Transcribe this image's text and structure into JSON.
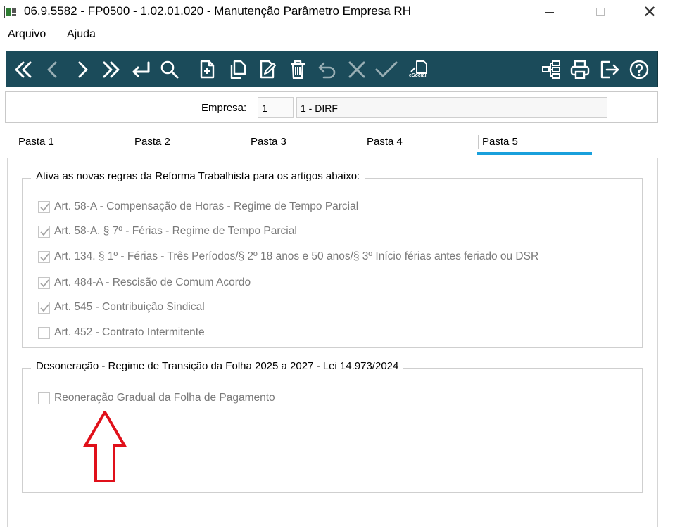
{
  "window": {
    "title": "06.9.5582 - FP0500 - 1.02.01.020 - Manutenção Parâmetro Empresa RH",
    "close_glyph": "✕"
  },
  "menu": {
    "items": [
      {
        "label": "Arquivo"
      },
      {
        "label": "Ajuda"
      }
    ]
  },
  "toolbar": {
    "background": "#1b4b5a",
    "icon_color": "#ffffff",
    "esocial_label": "eSocial",
    "buttons": [
      {
        "icon": "first-record-icon"
      },
      {
        "icon": "previous-record-icon"
      },
      {
        "icon": "next-record-icon"
      },
      {
        "icon": "last-record-icon"
      },
      {
        "icon": "return-icon"
      },
      {
        "icon": "search-icon"
      },
      {
        "icon": "new-document-icon"
      },
      {
        "icon": "copy-icon"
      },
      {
        "icon": "edit-icon"
      },
      {
        "icon": "delete-icon"
      },
      {
        "icon": "undo-icon"
      },
      {
        "icon": "cancel-icon"
      },
      {
        "icon": "confirm-icon"
      },
      {
        "icon": "esocial-icon"
      },
      {
        "icon": "hierarchy-icon"
      },
      {
        "icon": "print-icon"
      },
      {
        "icon": "exit-icon"
      },
      {
        "icon": "help-icon"
      }
    ]
  },
  "empresa": {
    "label": "Empresa:",
    "code": "1",
    "name": "1 - DIRF"
  },
  "tabs": [
    {
      "label": "Pasta 1",
      "active": false
    },
    {
      "label": "Pasta 2",
      "active": false
    },
    {
      "label": "Pasta 3",
      "active": false
    },
    {
      "label": "Pasta 4",
      "active": false
    },
    {
      "label": "Pasta 5",
      "active": true
    }
  ],
  "active_tab_color": "#19a0dc",
  "reforma": {
    "title": "Ativa as novas regras da Reforma Trabalhista para os artigos abaixo:",
    "items": [
      {
        "label": "Art. 58-A - Compensação de Horas - Regime de Tempo Parcial",
        "checked": true
      },
      {
        "label": "Art. 58-A. § 7º - Férias - Regime de Tempo Parcial",
        "checked": true
      },
      {
        "label": "Art. 134. § 1º - Férias - Três Períodos/§ 2º 18 anos e 50 anos/§ 3º Início férias antes feriado ou DSR",
        "checked": true
      },
      {
        "label": "Art. 484-A - Rescisão de Comum Acordo",
        "checked": true
      },
      {
        "label": "Art. 545 - Contribuição Sindical",
        "checked": true
      },
      {
        "label": "Art. 452 - Contrato Intermitente",
        "checked": false
      }
    ]
  },
  "desoneracao": {
    "title": "Desoneração - Regime de Transição da Folha 2025 a 2027 - Lei 14.973/2024",
    "items": [
      {
        "label": "Reoneração Gradual da Folha de Pagamento",
        "checked": false
      }
    ]
  },
  "annotation_arrow_color": "#e0101a"
}
